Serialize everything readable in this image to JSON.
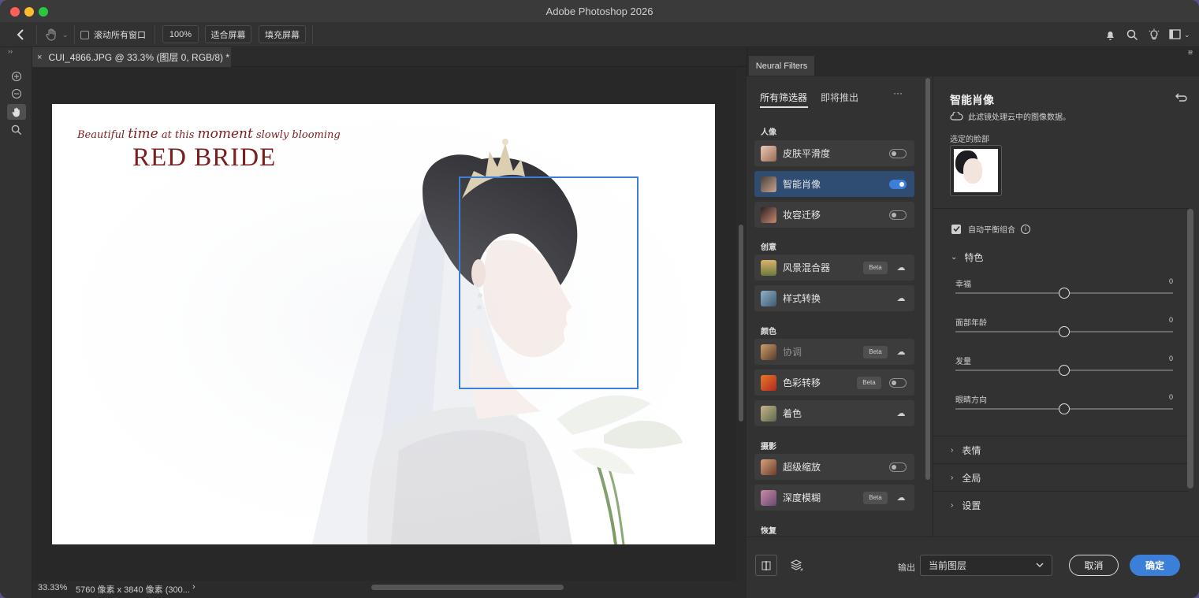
{
  "window": {
    "title": "Adobe Photoshop 2026"
  },
  "options_bar": {
    "scroll_all_label": "滚动所有窗口",
    "zoom_100": "100%",
    "fit_screen": "适合屏幕",
    "fill_screen": "填充屏幕"
  },
  "document": {
    "tab_title": "CUI_4866.JPG @ 33.3% (图层 0, RGB/8) *",
    "tab_close": "×",
    "zoom_status": "33.33%",
    "size_status": "5760 像素 x 3840 像素 (300...",
    "status_arrow": "›"
  },
  "photo": {
    "tagline_1": "Beautiful",
    "tagline_2": "time",
    "tagline_3": "at this",
    "tagline_4": "moment",
    "tagline_5": "slowly blooming",
    "title": "RED BRIDE"
  },
  "neural_filters": {
    "panel_tab": "Neural Filters",
    "tab_all": "所有筛选器",
    "tab_upcoming": "即将推出",
    "more": "···",
    "sections": [
      {
        "label": "人像",
        "items": [
          {
            "name": "皮肤平滑度",
            "control": "toggle",
            "on": false
          },
          {
            "name": "智能肖像",
            "control": "toggle",
            "on": true,
            "selected": true
          },
          {
            "name": "妆容迁移",
            "control": "toggle",
            "on": false
          }
        ]
      },
      {
        "label": "创意",
        "items": [
          {
            "name": "风景混合器",
            "beta": "Beta",
            "control": "cloud"
          },
          {
            "name": "样式转换",
            "control": "cloud"
          }
        ]
      },
      {
        "label": "颜色",
        "items": [
          {
            "name": "协调",
            "beta": "Beta",
            "control": "cloud",
            "disabled": true
          },
          {
            "name": "色彩转移",
            "beta": "Beta",
            "control": "toggle",
            "on": false
          },
          {
            "name": "着色",
            "control": "cloud"
          }
        ]
      },
      {
        "label": "摄影",
        "items": [
          {
            "name": "超级缩放",
            "control": "toggle",
            "on": false
          },
          {
            "name": "深度模糊",
            "beta": "Beta",
            "control": "cloud"
          }
        ]
      },
      {
        "label": "恢复",
        "items": []
      }
    ],
    "detail": {
      "title": "智能肖像",
      "cloud_note": "此滤镜处理云中的图像数据。",
      "selected_face_label": "选定的脸部",
      "auto_balance_label": "自动平衡组合",
      "featured_label": "特色",
      "sliders": [
        {
          "label": "幸福",
          "value": "0",
          "position": 0.5
        },
        {
          "label": "面部年龄",
          "value": "0",
          "position": 0.5
        },
        {
          "label": "发量",
          "value": "0",
          "position": 0.5
        },
        {
          "label": "眼睛方向",
          "value": "0",
          "position": 0.5
        }
      ],
      "collapsed": [
        "表情",
        "全局",
        "设置"
      ]
    },
    "footer": {
      "output_label": "输出",
      "output_value": "当前图层",
      "cancel": "取消",
      "ok": "确定"
    }
  },
  "colors": {
    "accent": "#3b7fd8",
    "selected_row": "#2f4c73",
    "title_red": "#7a1f1f"
  }
}
